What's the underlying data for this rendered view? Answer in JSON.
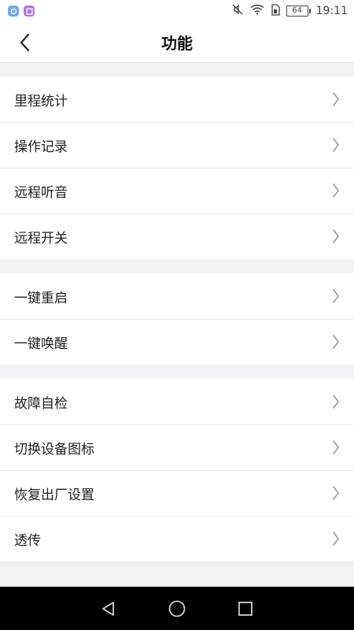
{
  "status_bar": {
    "time": "19:11",
    "battery": "64",
    "colors": {
      "badge1": "#7aa6ef",
      "badge2": "#b07be0"
    }
  },
  "header": {
    "title": "功能",
    "back_icon": "chevron-left-icon"
  },
  "groups": [
    {
      "items": [
        {
          "label": "里程统计"
        },
        {
          "label": "操作记录"
        },
        {
          "label": "远程听音"
        },
        {
          "label": "远程开关"
        }
      ]
    },
    {
      "items": [
        {
          "label": "一键重启"
        },
        {
          "label": "一键唤醒"
        }
      ]
    },
    {
      "items": [
        {
          "label": "故障自检"
        },
        {
          "label": "切换设备图标"
        },
        {
          "label": "恢复出厂设置"
        },
        {
          "label": "透传"
        }
      ]
    }
  ],
  "nav": {
    "back_icon": "triangle-back-icon",
    "home_icon": "circle-home-icon",
    "recent_icon": "square-recents-icon"
  }
}
